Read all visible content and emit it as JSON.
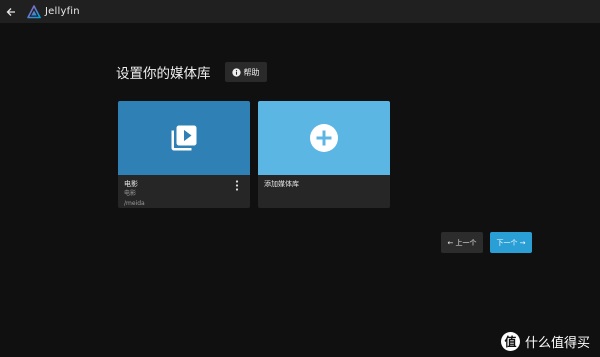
{
  "app": {
    "brand": "Jellyfin"
  },
  "page": {
    "title": "设置你的媒体库",
    "help_label": "帮助"
  },
  "libraries": [
    {
      "name": "电影",
      "type": "电影",
      "path": "/meida"
    },
    {
      "name": "添加媒体库"
    }
  ],
  "nav": {
    "prev_label": "← 上一个",
    "next_label": "下一个 →"
  },
  "watermark": {
    "badge": "值",
    "text": "什么值得买"
  },
  "colors": {
    "background": "#101010",
    "topbar": "#202020",
    "movie_card": "#2e80b5",
    "add_card": "#5cb6e4",
    "next_button": "#2a9fd6"
  },
  "icons": [
    "back-arrow-icon",
    "jellyfin-logo-icon",
    "info-icon",
    "video-library-icon",
    "add-circle-icon",
    "more-vert-icon"
  ]
}
